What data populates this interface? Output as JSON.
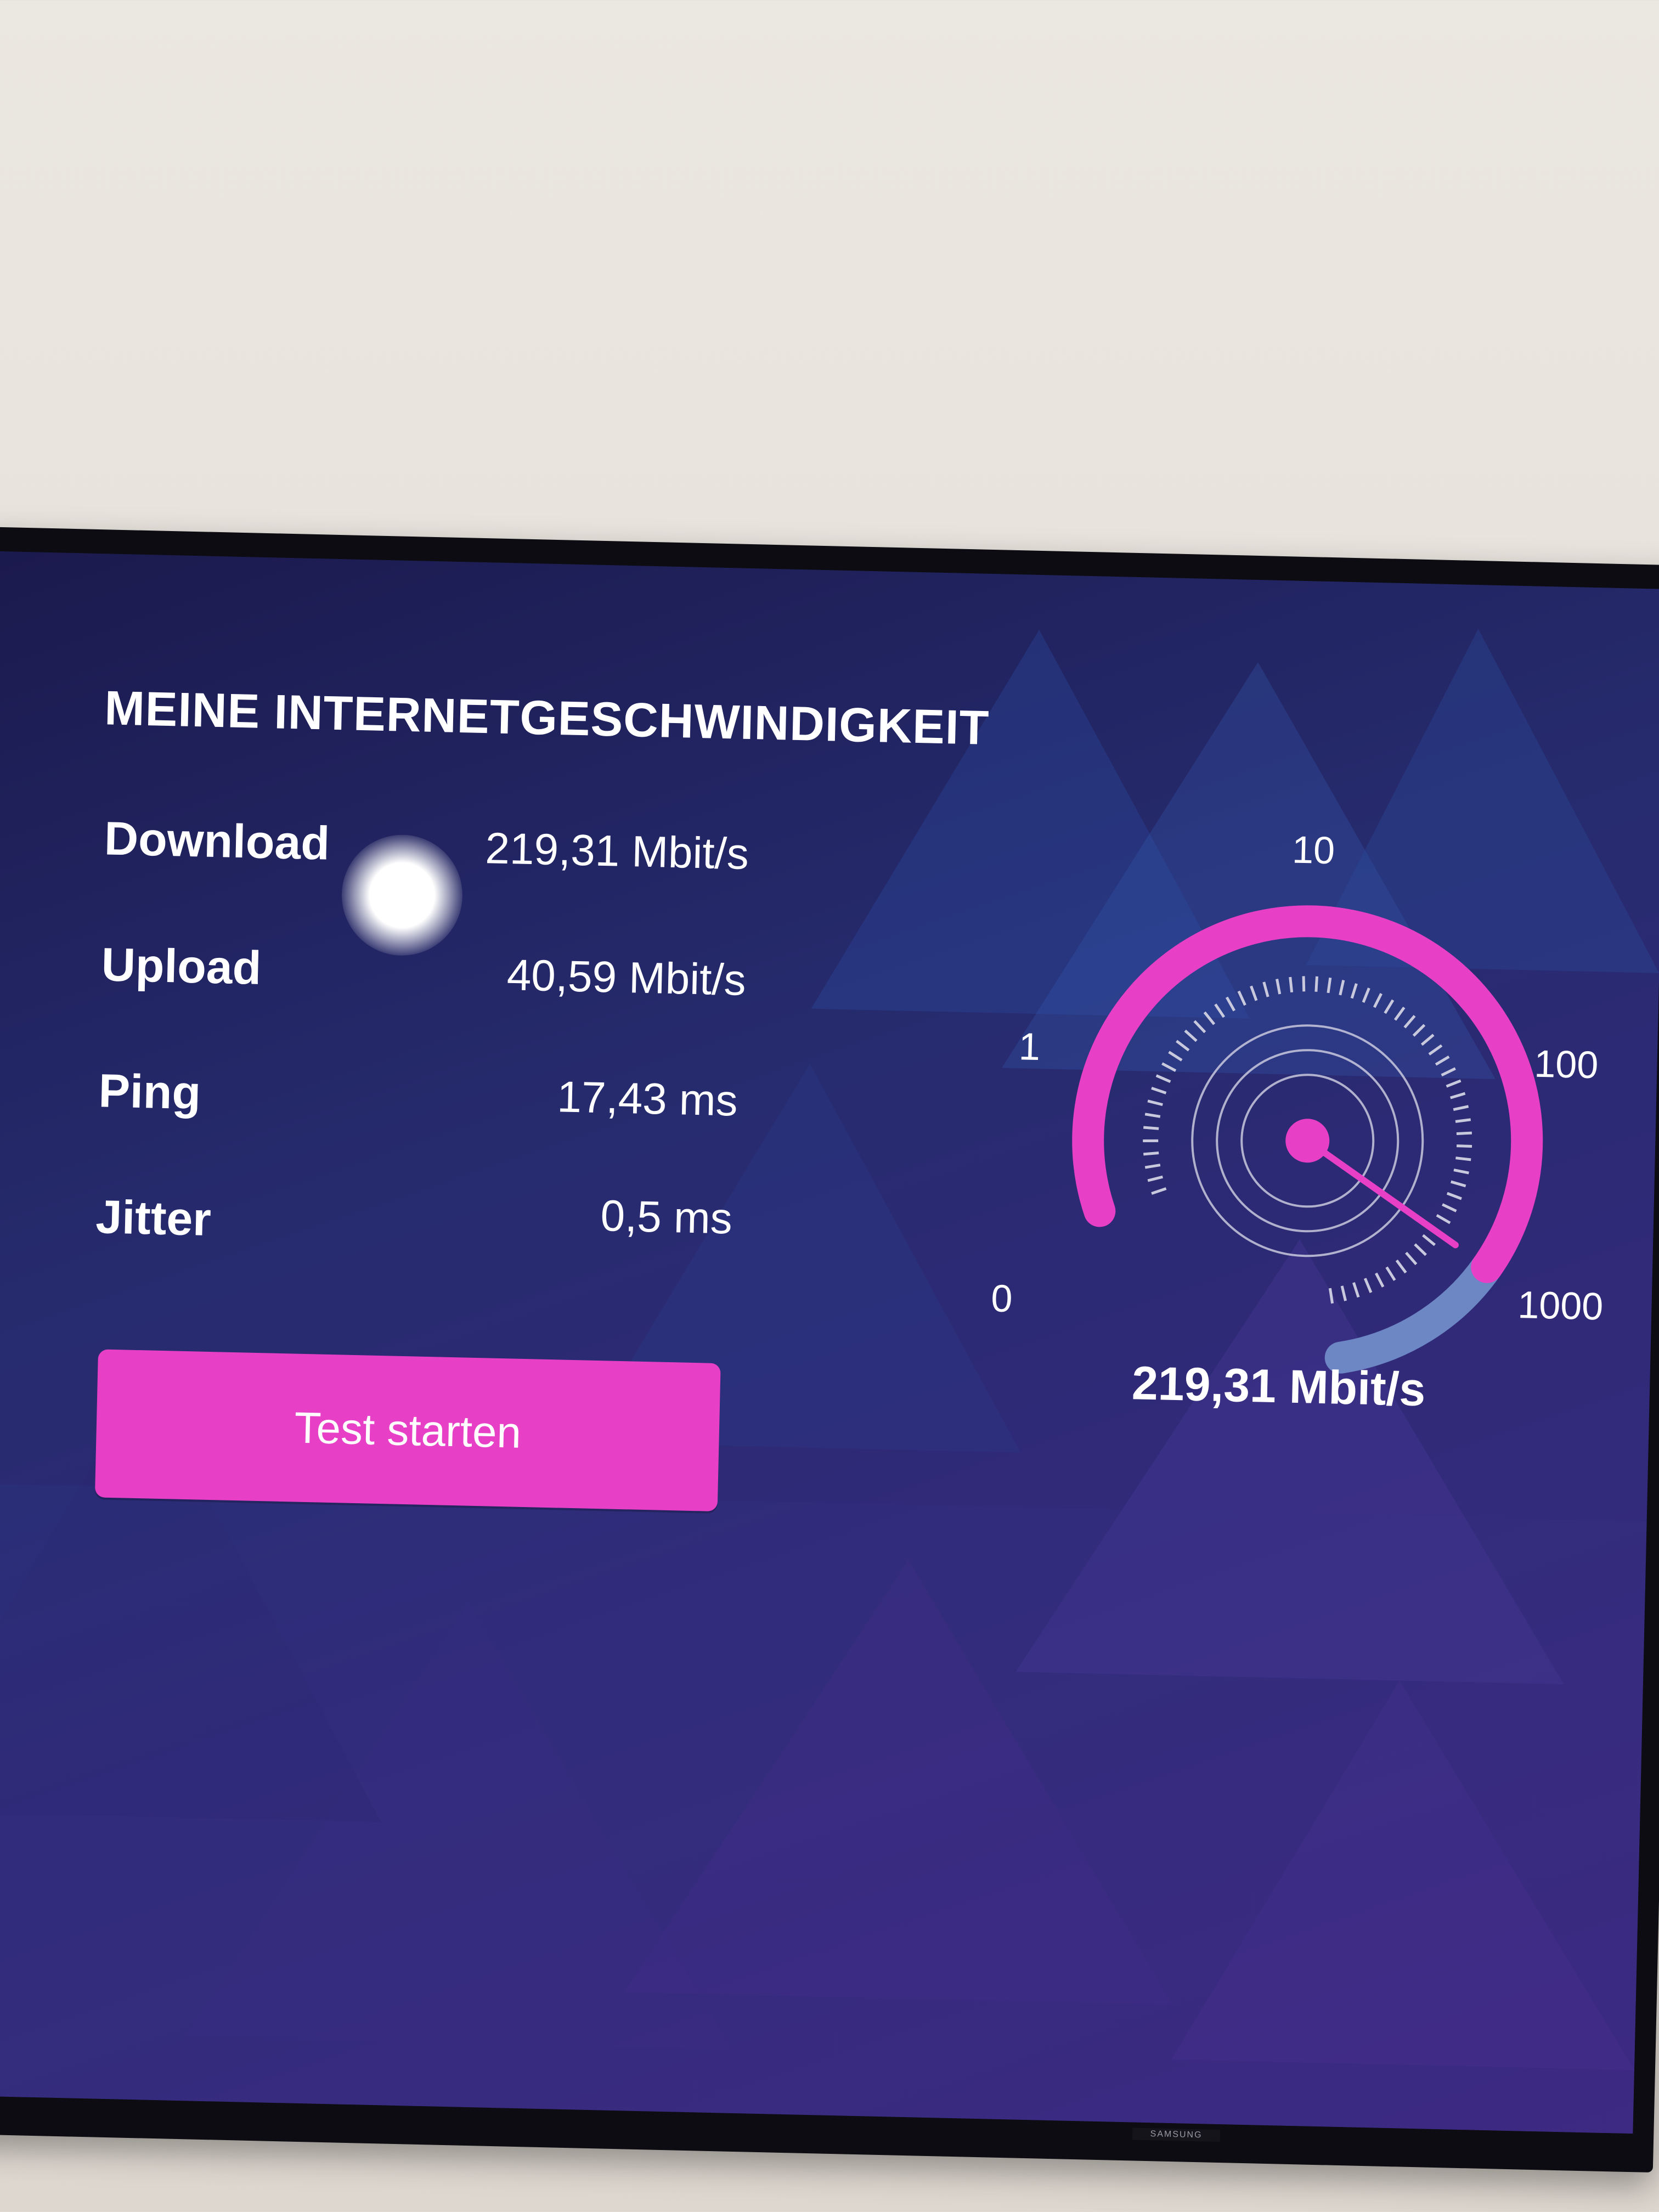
{
  "screen": {
    "title": "MEINE INTERNETGESCHWINDIGKEIT",
    "results": [
      {
        "label": "Download",
        "value": "219,31 Mbit/s"
      },
      {
        "label": "Upload",
        "value": "40,59 Mbit/s"
      },
      {
        "label": "Ping",
        "value": "17,43 ms"
      },
      {
        "label": "Jitter",
        "value": "0,5 ms"
      }
    ],
    "start_button": "Test starten"
  },
  "gauge": {
    "scale_labels": [
      "0",
      "1",
      "10",
      "100",
      "1000"
    ],
    "scale_type": "log",
    "current_value": 219.31,
    "readout": "219,31 Mbit/s"
  },
  "tv": {
    "brand": "SAMSUNG"
  },
  "colors": {
    "accent": "#e83fc7",
    "gauge_remaining": "#6d86c4",
    "background_top": "#1b1a4e",
    "background_bottom": "#3a2a82",
    "text": "#ffffff"
  }
}
